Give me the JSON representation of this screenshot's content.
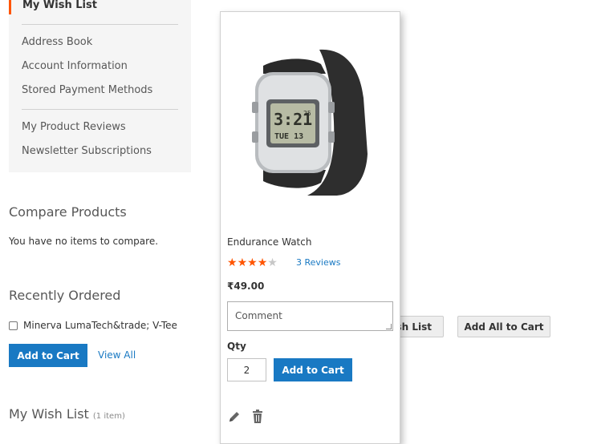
{
  "sidebar": {
    "current_item": "My Wish List",
    "items": [
      {
        "label": "Address Book"
      },
      {
        "label": "Account Information"
      },
      {
        "label": "Stored Payment Methods"
      },
      {
        "label": "My Product Reviews"
      },
      {
        "label": "Newsletter Subscriptions"
      }
    ],
    "accent_color": "#ff5501"
  },
  "compare": {
    "title": "Compare Products",
    "empty_text": "You have no items to compare."
  },
  "recently_ordered": {
    "title": "Recently Ordered",
    "item_label": "Minerva LumaTech&trade; V-Tee",
    "add_to_cart": "Add to Cart",
    "view_all": "View All"
  },
  "wishlist_block": {
    "title": "My Wish List",
    "count": "(1 item)"
  },
  "product": {
    "name": "Endurance Watch",
    "rating_stars": 4.5,
    "rating_max": 5,
    "reviews": "3  Reviews",
    "price": "₹49.00",
    "comment_placeholder": "Comment",
    "qty_label": "Qty",
    "qty_value": "2",
    "add_to_cart": "Add to Cart",
    "watch_time": "3:21",
    "watch_seconds": "25",
    "watch_date": "TUE 13"
  },
  "actions": {
    "share_partial": "sh List",
    "add_all_to_cart": "Add All to Cart"
  },
  "colors": {
    "primary": "#1979c3",
    "link": "#1979c3",
    "star": "#ff5501"
  }
}
